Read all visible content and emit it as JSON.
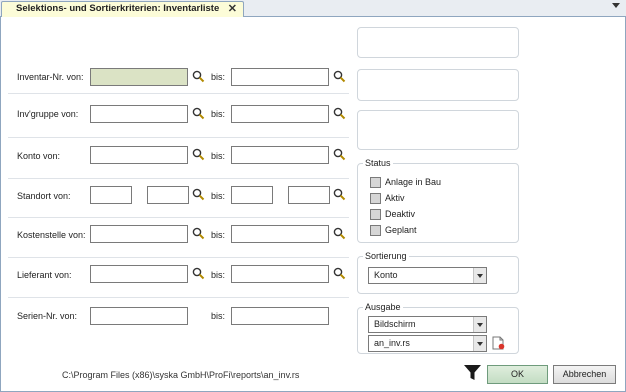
{
  "tab": {
    "title": "Selektions- und Sortierkriterien: Inventarliste",
    "close": "✕"
  },
  "filters": [
    {
      "label": "Inventar-Nr. von:",
      "bis_label": "bis:",
      "from_value": "",
      "to_value": ""
    },
    {
      "label": "Inv'gruppe von:",
      "bis_label": "bis:",
      "from_value": "",
      "to_value": ""
    },
    {
      "label": "Konto von:",
      "bis_label": "bis:",
      "from_value": "",
      "to_value": ""
    },
    {
      "label": "Standort von:",
      "bis_label": "bis:",
      "from_value_a": "",
      "from_value_b": "",
      "to_value_a": "",
      "to_value_b": ""
    },
    {
      "label": "Kostenstelle von:",
      "bis_label": "bis:",
      "from_value": "",
      "to_value": ""
    },
    {
      "label": "Lieferant  von:",
      "bis_label": "bis:",
      "from_value": "",
      "to_value": ""
    },
    {
      "label": "Serien-Nr. von:",
      "bis_label": "bis:",
      "from_value": "",
      "to_value": ""
    }
  ],
  "status": {
    "title": "Status",
    "options": [
      {
        "label": "Anlage in Bau",
        "checked": false
      },
      {
        "label": "Aktiv",
        "checked": false
      },
      {
        "label": "Deaktiv",
        "checked": false
      },
      {
        "label": "Geplant",
        "checked": false
      }
    ]
  },
  "sortierung": {
    "title": "Sortierung",
    "selected": "Konto"
  },
  "ausgabe": {
    "title": "Ausgabe",
    "device": "Bildschirm",
    "report": "an_inv.rs"
  },
  "footer": {
    "path": "C:\\Program Files (x86)\\syska GmbH\\ProFi\\reports\\an_inv.rs",
    "ok_label": "OK",
    "cancel_label": "Abbrechen"
  },
  "colors": {
    "highlight_field": "#dbe3c5",
    "tab_active": "#fcfcd8",
    "ok_button": "#c3dcc3"
  }
}
